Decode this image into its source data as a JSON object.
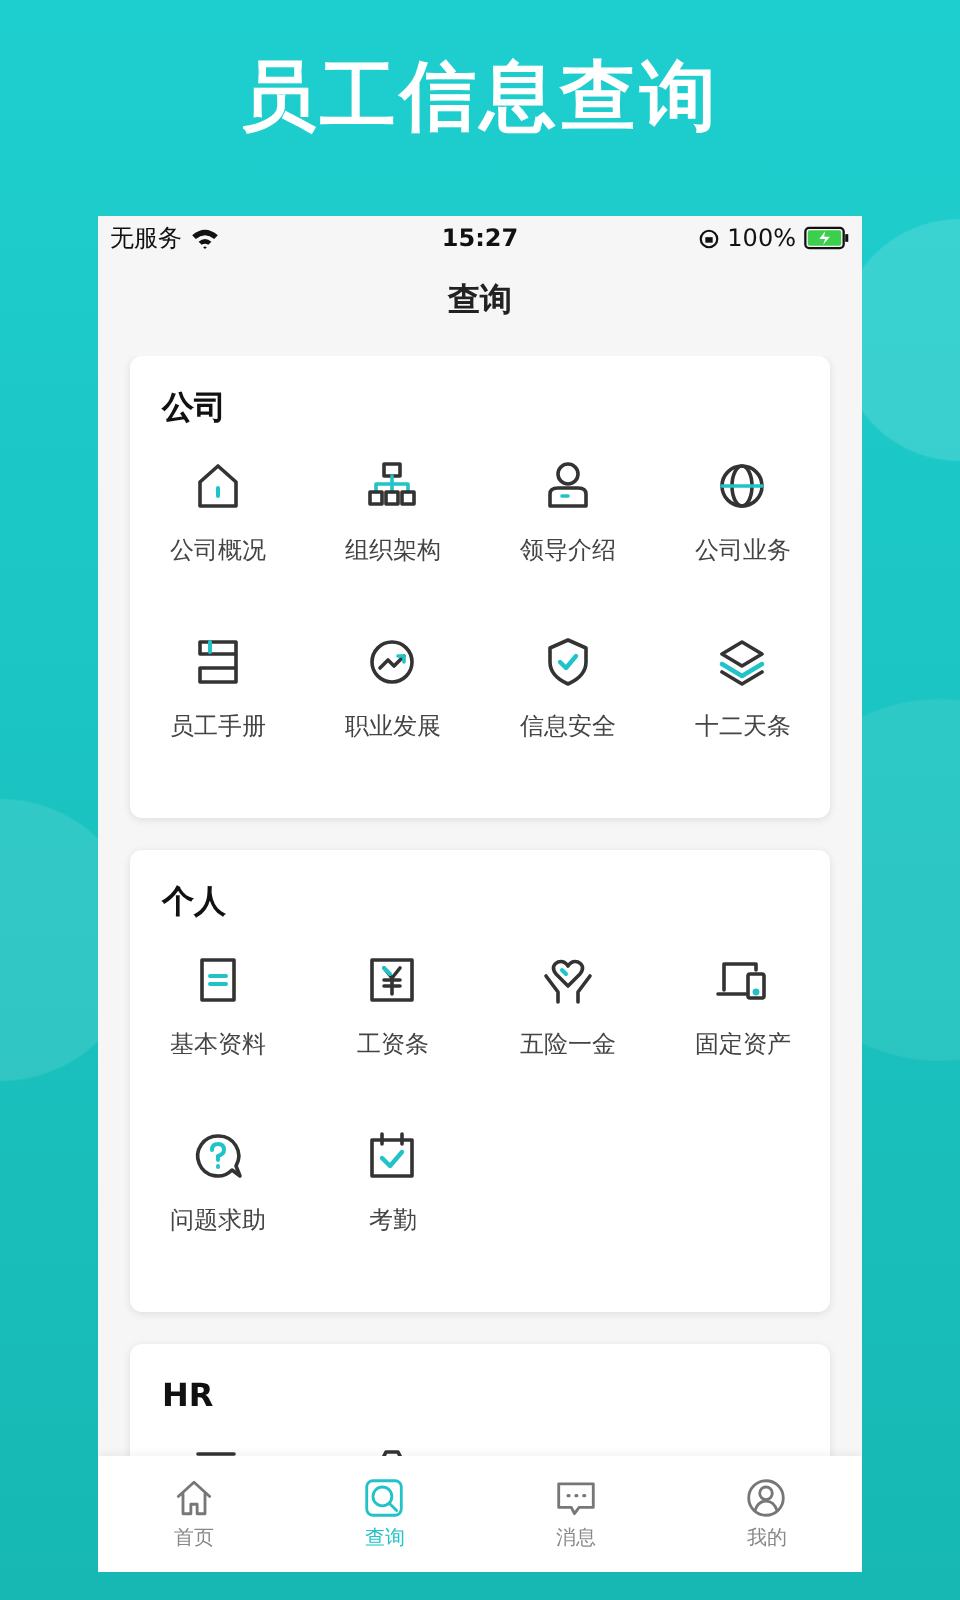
{
  "banner": {
    "title": "员工信息查询"
  },
  "status_bar": {
    "carrier": "无服务",
    "time": "15:27",
    "battery": "100%"
  },
  "nav": {
    "title": "查询"
  },
  "sections": [
    {
      "title": "公司",
      "items": [
        {
          "label": "公司概况"
        },
        {
          "label": "组织架构"
        },
        {
          "label": "领导介绍"
        },
        {
          "label": "公司业务"
        },
        {
          "label": "员工手册"
        },
        {
          "label": "职业发展"
        },
        {
          "label": "信息安全"
        },
        {
          "label": "十二天条"
        }
      ]
    },
    {
      "title": "个人",
      "items": [
        {
          "label": "基本资料"
        },
        {
          "label": "工资条"
        },
        {
          "label": "五险一金"
        },
        {
          "label": "固定资产"
        },
        {
          "label": "问题求助"
        },
        {
          "label": "考勤"
        }
      ]
    },
    {
      "title": "HR"
    }
  ],
  "tab_bar": [
    {
      "label": "首页",
      "selected": false
    },
    {
      "label": "查询",
      "selected": true
    },
    {
      "label": "消息",
      "selected": false
    },
    {
      "label": "我的",
      "selected": false
    }
  ]
}
